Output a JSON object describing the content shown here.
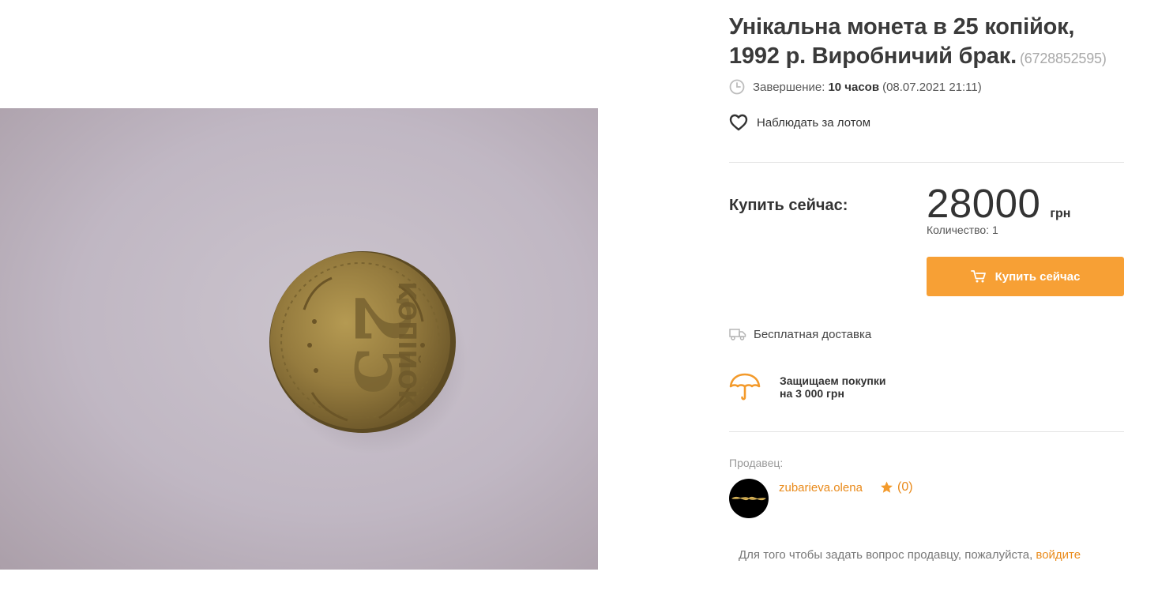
{
  "listing": {
    "title": "Унікальна монета в 25 копійок, 1992 р. Виробничий брак.",
    "lot_id": "(6728852595)",
    "ending": {
      "label": "Завершение:",
      "remaining": "10 часов",
      "date": "(08.07.2021 21:11)",
      "icon": "clock-icon"
    },
    "watch": {
      "label": "Наблюдать за лотом",
      "icon": "heart-icon"
    },
    "photo": {
      "alt": "coin-photo"
    }
  },
  "purchase": {
    "buy_now_label": "Купить сейчас:",
    "price": "28000",
    "currency": "грн",
    "quantity": "Количество: 1",
    "button_label": "Купить сейчас",
    "button_icon": "cart-icon",
    "button_color": "#f7a035"
  },
  "delivery": {
    "label": "Бесплатная доставка",
    "icon": "truck-icon"
  },
  "protection": {
    "line1": "Защищаем покупки",
    "line2": "на 3 000 грн",
    "icon": "umbrella-icon"
  },
  "seller": {
    "label": "Продавец:",
    "name": "zubarieva.olena",
    "rating": "(0)",
    "icon": "star-icon",
    "accent_color": "#e98a1a"
  },
  "question": {
    "text": "Для того чтобы задать вопрос продавцу, пожалуйста,",
    "link": "войдите"
  }
}
